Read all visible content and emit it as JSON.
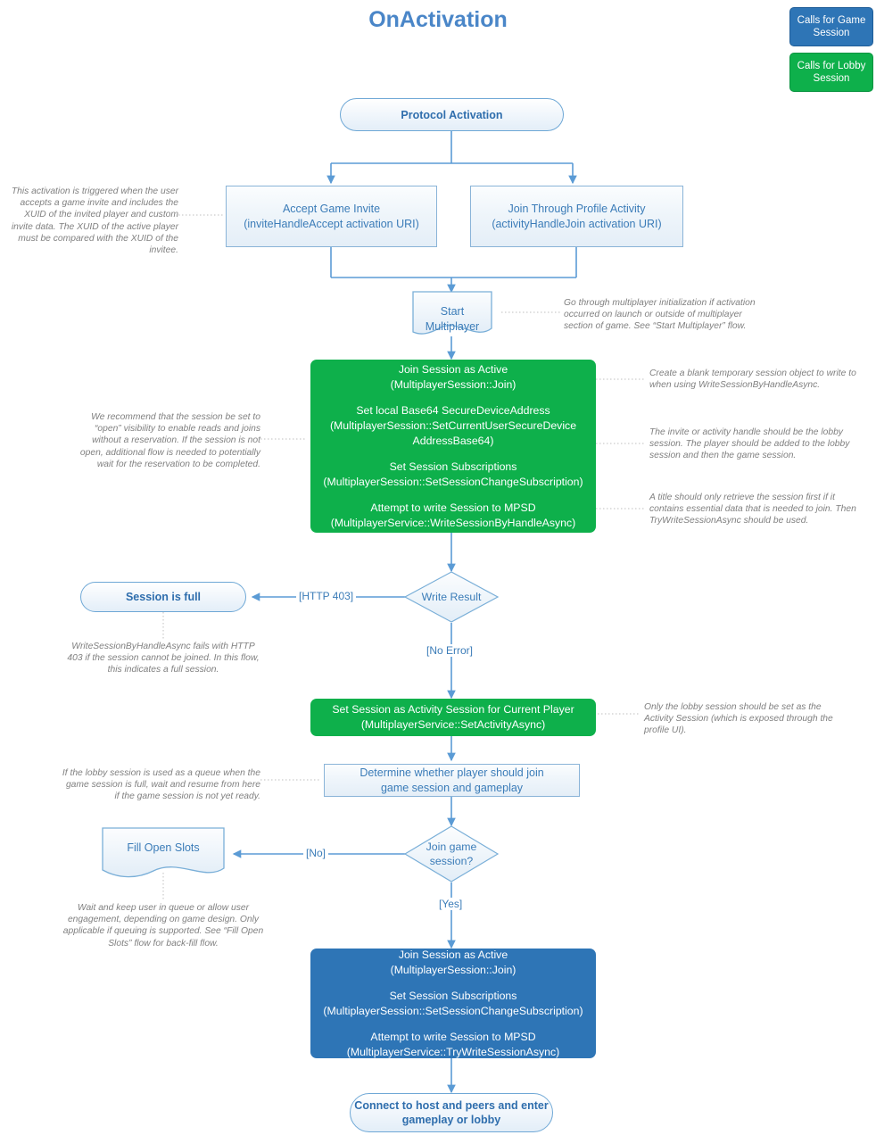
{
  "title": "OnActivation",
  "legend": {
    "game": "Calls for Game Session",
    "lobby": "Calls for Lobby Session",
    "game_color": "#2e75b6",
    "lobby_color": "#0eb04b"
  },
  "accent": {
    "blue_text": "#3b7cb8",
    "title_blue": "#4a86c8",
    "note_grey": "#808080",
    "star_orange": "#ed7d31"
  },
  "nodes": {
    "protocol_activation": "Protocol Activation",
    "accept_invite_l1": "Accept Game Invite",
    "accept_invite_l2": "(inviteHandleAccept activation URI)",
    "join_profile_l1": "Join Through Profile Activity",
    "join_profile_l2": "(activityHandleJoin activation URI)",
    "start_multiplayer": "Start Multiplayer",
    "join_lobby_box": {
      "g1a": "Join Session as Active",
      "g1b": "(MultiplayerSession::Join)",
      "g2a": "Set local Base64 SecureDeviceAddress",
      "g2b": "(MultiplayerSession::SetCurrentUserSecureDevice AddressBase64)",
      "g3a": "Set Session Subscriptions",
      "g3b": "(MultiplayerSession::SetSessionChangeSubscription)",
      "g4a": "Attempt to write Session to MPSD",
      "g4b": "(MultiplayerService::WriteSessionByHandleAsync)"
    },
    "write_result": "Write Result",
    "session_is_full": "Session is full",
    "set_activity_l1": "Set Session as Activity Session for Current Player",
    "set_activity_l2": "(MultiplayerService::SetActivityAsync)",
    "determine_l1": "Determine whether player should join",
    "determine_l2": "game session and gameplay",
    "join_game_session_q_l1": "Join game",
    "join_game_session_q_l2": "session?",
    "fill_open_slots": "Fill Open Slots",
    "join_game_box": {
      "g1a": "Join Session as Active",
      "g1b": "(MultiplayerSession::Join)",
      "g2a": "Set Session Subscriptions",
      "g2b": "(MultiplayerSession::SetSessionChangeSubscription)",
      "g3a": "Attempt to write Session to MPSD",
      "g3b": "(MultiplayerService::TryWriteSessionAsync)"
    },
    "connect_l1": "Connect to host and peers and enter",
    "connect_l2": "gameplay or lobby"
  },
  "edge_labels": {
    "http403": "[HTTP 403]",
    "no_error": "[No Error]",
    "no": "[No]",
    "yes": "[Yes]"
  },
  "notes": {
    "invite_note": "This activation is triggered when the user accepts a game invite and includes the XUID of the invited player and custom invite data. The XUID of the active player must be compared with the XUID of the invitee.",
    "start_mp_note": "Go through multiplayer initialization if activation occurred on launch or outside of multiplayer section of game. See “Start Multiplayer” flow.",
    "open_visibility_note": "We recommend that the session be set to “open” visibility to enable reads and joins without a reservation. If the session is not open, additional flow is needed to potentially wait for the reservation to be completed.",
    "blank_session_note": "Create a blank temporary session object to write to when using WriteSessionByHandleAsync.",
    "handle_note": "The invite or activity handle should be the lobby session. The player should be added to the lobby session and then the game session.",
    "retrieve_note": "A title should only retrieve the session first if it contains essential data that is needed to join. Then TryWriteSessionAsync should be used.",
    "http403_note": "WriteSessionByHandleAsync fails with HTTP 403 if the session cannot be joined. In this flow, this indicates a full session.",
    "activity_session_note": "Only the lobby session should be set as the Activity Session (which is exposed through the profile UI).",
    "queue_note": "If the lobby session is used as a queue when the game session is full, wait and resume from here if the game session is not yet ready.",
    "fill_slots_note": "Wait and keep user in queue or allow user engagement, depending on game design. Only applicable if queuing is supported. See “Fill Open Slots” flow for back-fill flow."
  },
  "icons": {
    "star_game": "four-point-star-icon",
    "star_lobby": "four-point-star-icon"
  }
}
